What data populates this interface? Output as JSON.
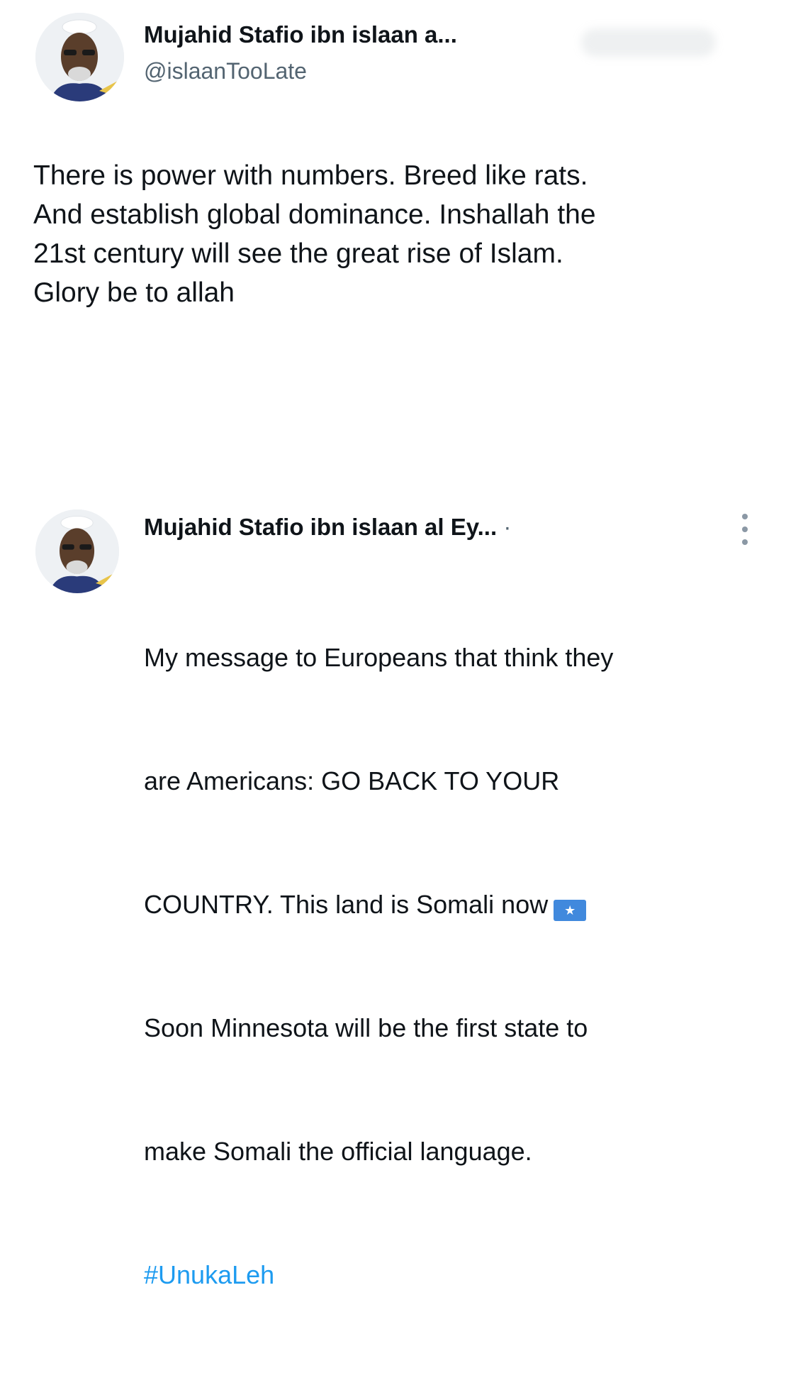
{
  "post1": {
    "display_name": "Mujahid Stafio ibn islaan a...",
    "handle": "@islaanTooLate",
    "text": "There is power with numbers. Breed like rats.\nAnd establish global dominance. Inshallah the\n21st century will see the great rise of Islam.\nGlory be to allah"
  },
  "post2": {
    "display_name": "Mujahid Stafio ibn islaan al Ey...",
    "separator": "·",
    "text_line1": "My message to Europeans that think they",
    "text_line2": "are Americans: GO BACK TO YOUR",
    "text_line3": "COUNTRY. This land is Somali now",
    "flag_emoji": "★",
    "text_line4": "Soon Minnesota will be the first state to",
    "text_line5": "make Somali the official language.",
    "hashtag": "#UnukaLeh"
  },
  "icons": {
    "avatar": "avatar-photo",
    "more": "more-vertical-icon",
    "flag": "somalia-flag-emoji"
  },
  "colors": {
    "text": "#0f1419",
    "secondary": "#536471",
    "link": "#1d9bf0",
    "flag_blue": "#4189dd"
  }
}
